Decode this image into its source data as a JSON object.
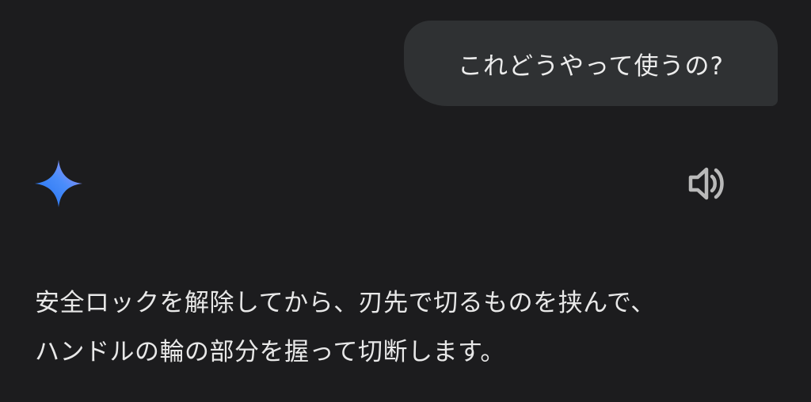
{
  "user_message": {
    "text": "これどうやって使うの?"
  },
  "assistant": {
    "icon": "gemini-sparkle-icon",
    "speaker_icon": "volume-icon",
    "response_lines": [
      "安全ロックを解除してから、刃先で切るものを挟んで、",
      "ハンドルの輪の部分を握って切断します。"
    ]
  },
  "colors": {
    "background": "#1c1c1e",
    "bubble": "#2f3133",
    "sparkle_start": "#2f7dff",
    "sparkle_end": "#b08cf5",
    "icon_gray": "#b9b9b9"
  }
}
